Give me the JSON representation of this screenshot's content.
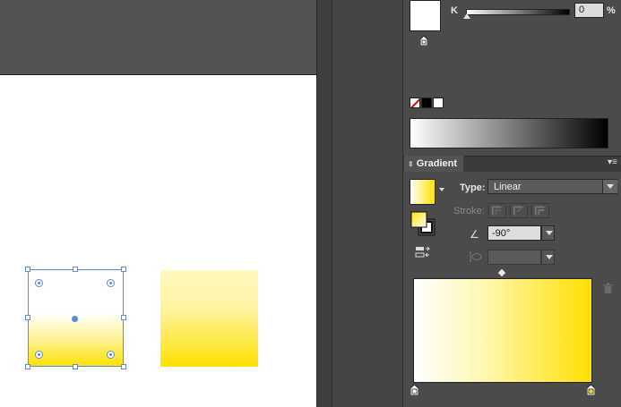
{
  "color_panel": {
    "channel_label": "K",
    "channel_value": "0",
    "channel_unit": "%",
    "k_percent": 0,
    "swatches": [
      {
        "name": "none",
        "color": "none"
      },
      {
        "name": "black",
        "color": "#000000"
      },
      {
        "name": "white",
        "color": "#ffffff"
      }
    ]
  },
  "gradient_panel": {
    "tab_label": "Gradient",
    "type_label": "Type:",
    "type_value": "Linear",
    "stroke_label": "Stroke:",
    "angle_value": "-90°",
    "stops": [
      {
        "location_percent": 0,
        "color": "#ffffff"
      },
      {
        "location_percent": 100,
        "color": "#ffe000"
      }
    ],
    "midpoint_percent": 50
  },
  "colors": {
    "gradient_start": "#ffffff",
    "gradient_end": "#ffe000",
    "selection": "#5b8ad8"
  }
}
